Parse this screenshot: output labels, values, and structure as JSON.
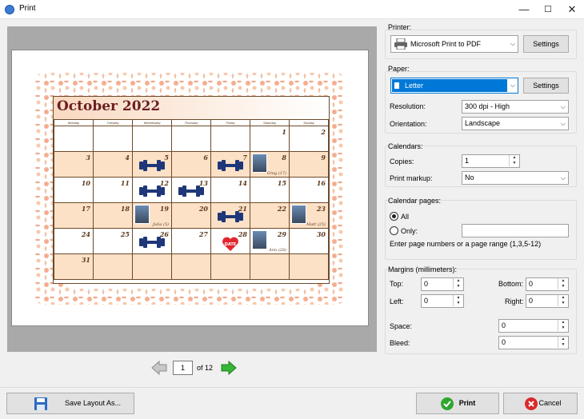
{
  "window": {
    "title": "Print",
    "minimize": "—",
    "maximize": "☐",
    "close": "✕"
  },
  "calendar": {
    "title": "October 2022",
    "weekdays": [
      "Monday",
      "Tuesday",
      "Wednesday",
      "Thursday",
      "Friday",
      "Saturday",
      "Sunday"
    ],
    "weeks": [
      [
        "",
        "",
        "",
        "",
        "",
        "1",
        "2"
      ],
      [
        "3",
        "4",
        "5",
        "6",
        "7",
        "8",
        "9"
      ],
      [
        "10",
        "11",
        "12",
        "13",
        "14",
        "15",
        "16"
      ],
      [
        "17",
        "18",
        "19",
        "20",
        "21",
        "22",
        "23"
      ],
      [
        "24",
        "25",
        "26",
        "27",
        "28",
        "29",
        "30"
      ],
      [
        "31",
        "",
        "",
        "",
        "",
        "",
        ""
      ]
    ],
    "photo_labels": {
      "greg": "Greg (17)",
      "julia": "Julia (5)",
      "matt": "Matt (25)",
      "ann": "Ann (28)"
    },
    "date_badge": "DATE"
  },
  "navigation": {
    "current_page": "1",
    "of_label": "of 12"
  },
  "printer": {
    "group_label": "Printer:",
    "selected": "Microsoft Print to PDF",
    "settings_label": "Settings"
  },
  "paper": {
    "group_label": "Paper:",
    "selected": "Letter",
    "settings_label": "Settings",
    "resolution_label": "Resolution:",
    "resolution_value": "300 dpi - High",
    "orientation_label": "Orientation:",
    "orientation_value": "Landscape"
  },
  "calendars": {
    "group_label": "Calendars:",
    "copies_label": "Copies:",
    "copies_value": "1",
    "markup_label": "Print markup:",
    "markup_value": "No"
  },
  "calendar_pages": {
    "group_label": "Calendar pages:",
    "all_label": "All",
    "only_label": "Only:",
    "hint": "Enter page numbers or a page range (1,3,5-12)"
  },
  "margins": {
    "group_label": "Margins (millimeters):",
    "top_label": "Top:",
    "top_value": "0",
    "bottom_label": "Bottom:",
    "bottom_value": "0",
    "left_label": "Left:",
    "left_value": "0",
    "right_label": "Right:",
    "right_value": "0",
    "space_label": "Space:",
    "space_value": "0",
    "bleed_label": "Bleed:",
    "bleed_value": "0"
  },
  "buttons": {
    "save_layout": "Save Layout As...",
    "print": "Print",
    "cancel": "Cancel"
  },
  "colors": {
    "accent": "#0078d7",
    "print_icon": "#2fa52f",
    "cancel_icon": "#d92a2a"
  }
}
